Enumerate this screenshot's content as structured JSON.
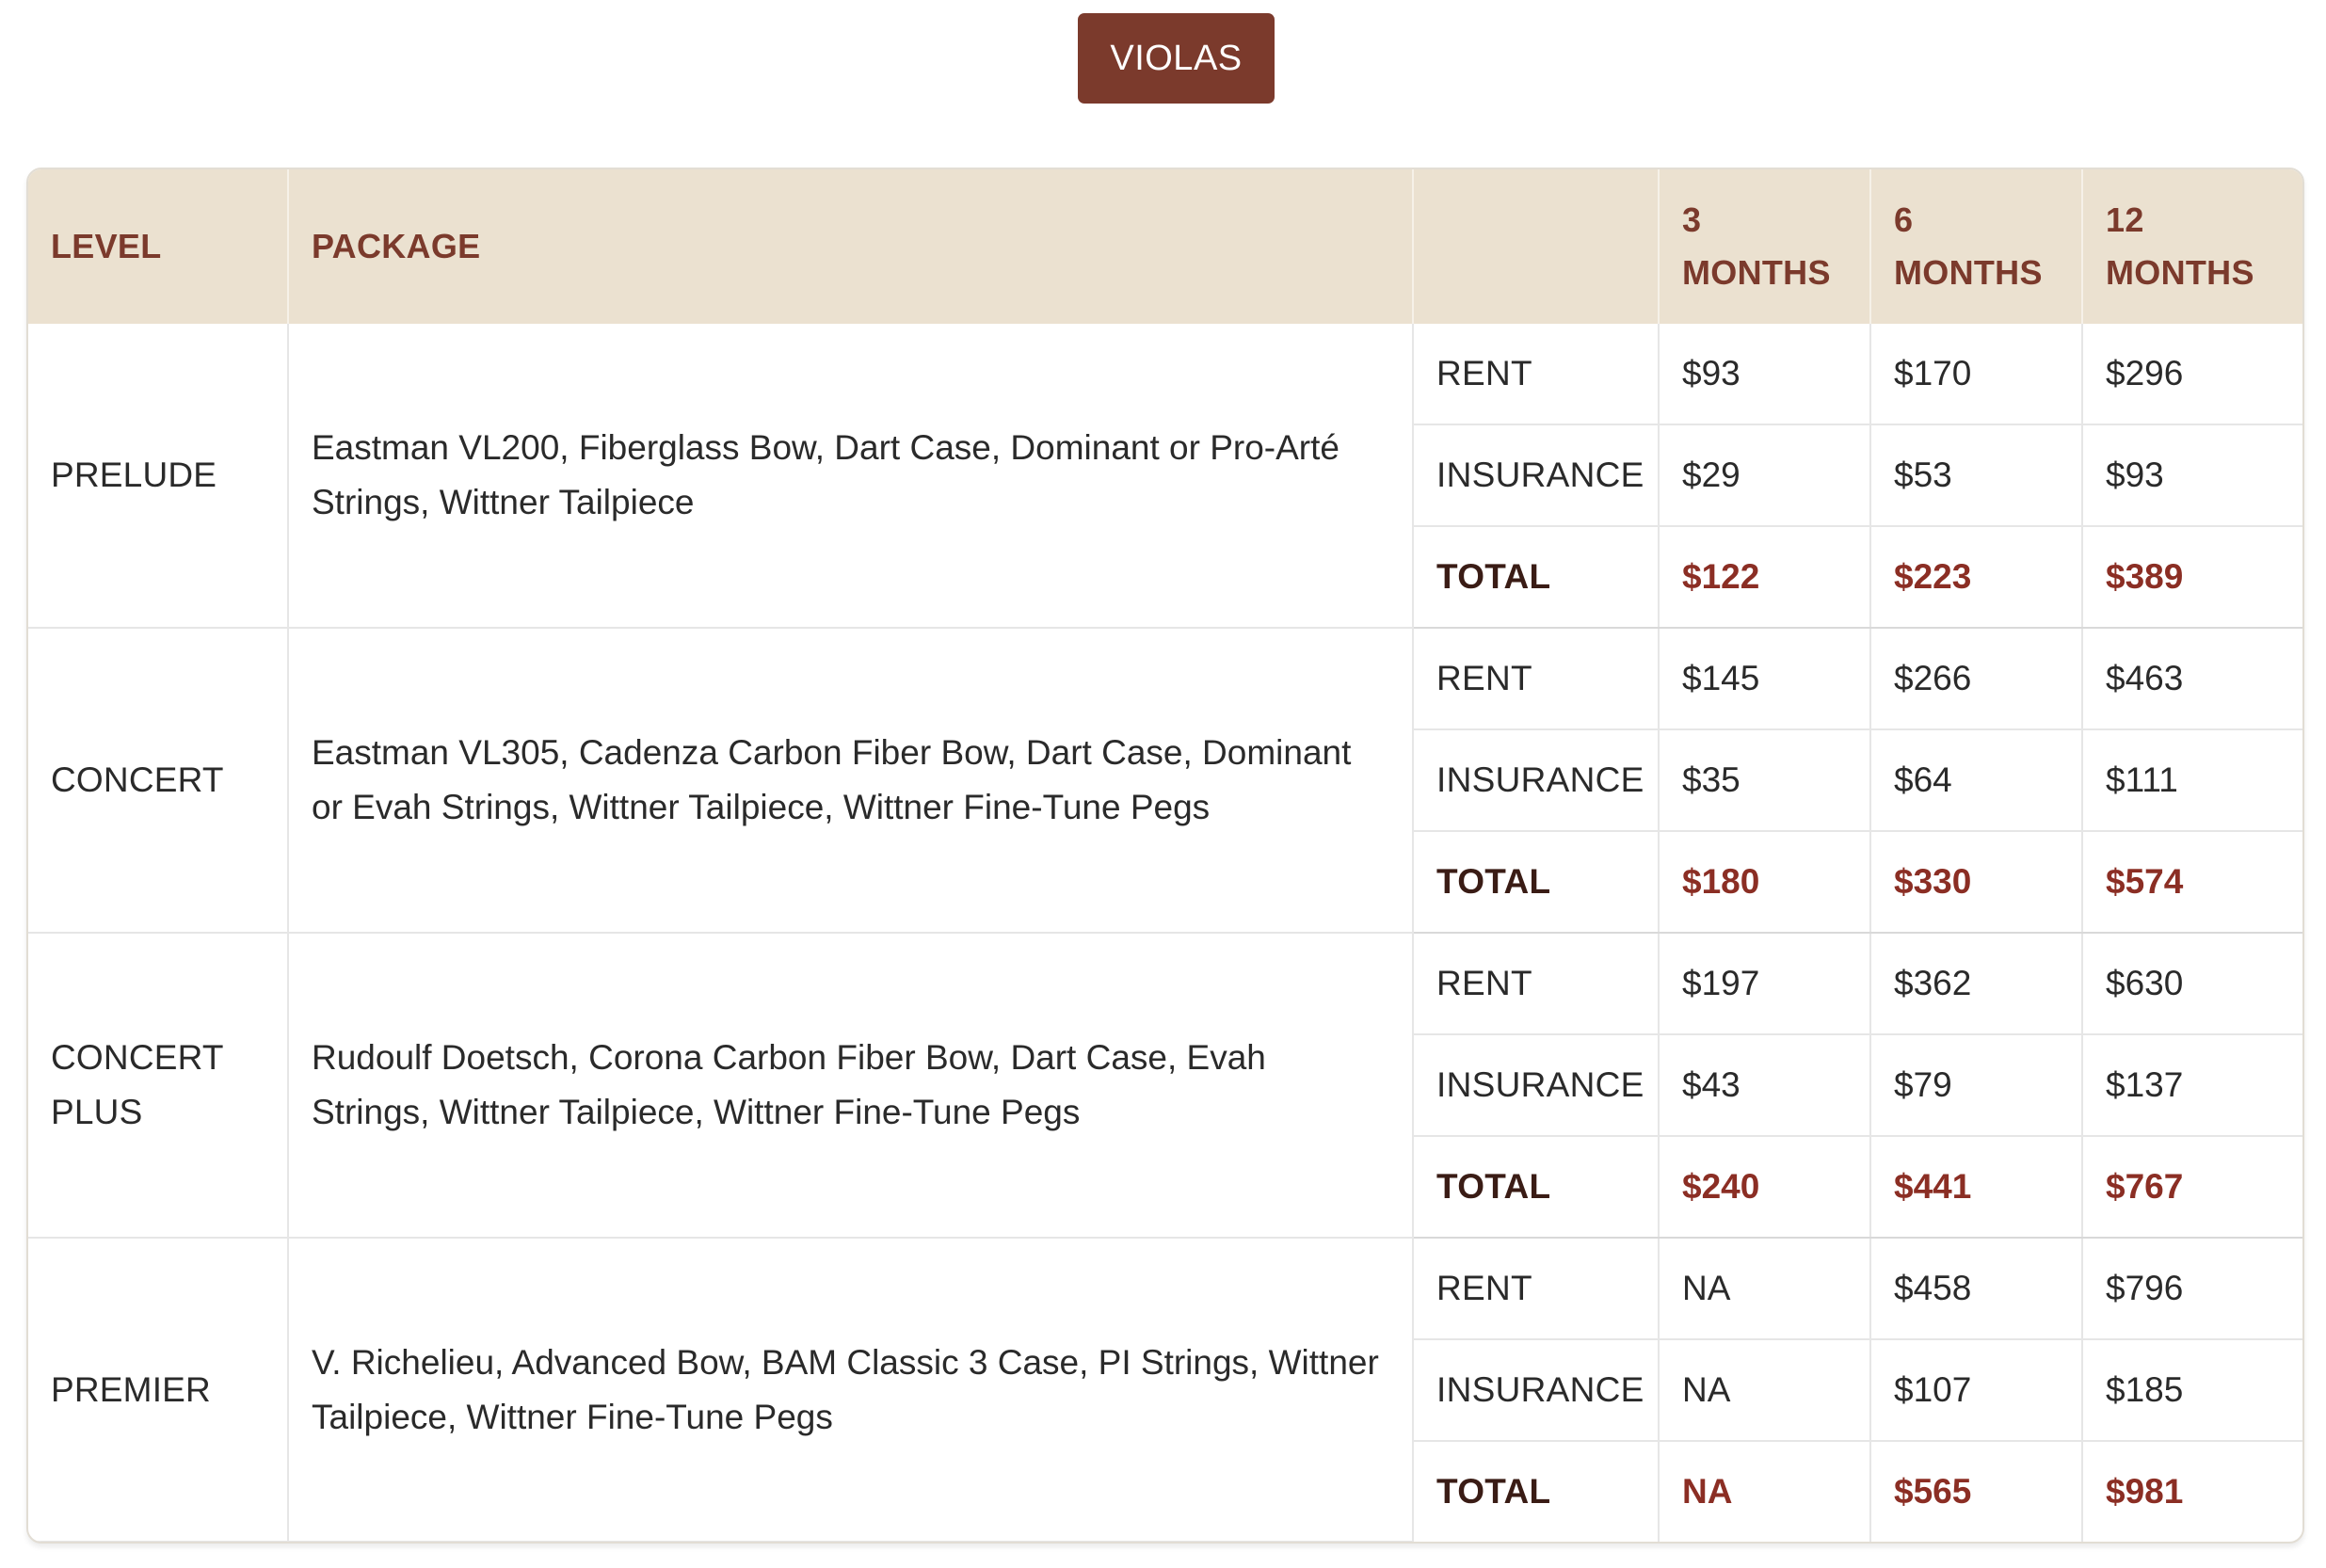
{
  "tab": {
    "label": "VIOLAS"
  },
  "table": {
    "headers": {
      "level": "LEVEL",
      "package": "PACKAGE",
      "type": "",
      "m3_num": "3",
      "m3_word": "MONTHS",
      "m6_num": "6",
      "m6_word": "MONTHS",
      "m12_num": "12",
      "m12_word": "MONTHS"
    },
    "groups": [
      {
        "level": "PRELUDE",
        "package": "Eastman VL200, Fiberglass Bow, Dart Case, Dominant or Pro-Arté Strings, Wittner Tailpiece",
        "rows": [
          {
            "type": "RENT",
            "m3": "$93",
            "m6": "$170",
            "m12": "$296"
          },
          {
            "type": "INSURANCE",
            "m3": "$29",
            "m6": "$53",
            "m12": "$93"
          },
          {
            "type": "TOTAL",
            "m3": "$122",
            "m6": "$223",
            "m12": "$389"
          }
        ]
      },
      {
        "level": "CONCERT",
        "package": "Eastman VL305, Cadenza Carbon Fiber Bow, Dart Case, Dominant or Evah Strings, Wittner Tailpiece, Wittner Fine-Tune Pegs",
        "rows": [
          {
            "type": "RENT",
            "m3": "$145",
            "m6": "$266",
            "m12": "$463"
          },
          {
            "type": "INSURANCE",
            "m3": "$35",
            "m6": "$64",
            "m12": "$111"
          },
          {
            "type": "TOTAL",
            "m3": "$180",
            "m6": "$330",
            "m12": "$574"
          }
        ]
      },
      {
        "level": "CONCERT PLUS",
        "package": "Rudoulf Doetsch, Corona Carbon Fiber Bow, Dart Case, Evah Strings, Wittner Tailpiece, Wittner Fine-Tune Pegs",
        "rows": [
          {
            "type": "RENT",
            "m3": "$197",
            "m6": "$362",
            "m12": "$630"
          },
          {
            "type": "INSURANCE",
            "m3": "$43",
            "m6": "$79",
            "m12": "$137"
          },
          {
            "type": "TOTAL",
            "m3": "$240",
            "m6": "$441",
            "m12": "$767"
          }
        ]
      },
      {
        "level": "PREMIER",
        "package": "V. Richelieu, Advanced Bow, BAM Classic 3 Case, PI Strings, Wittner Tailpiece, Wittner Fine-Tune Pegs",
        "rows": [
          {
            "type": "RENT",
            "m3": "NA",
            "m6": "$458",
            "m12": "$796"
          },
          {
            "type": "INSURANCE",
            "m3": "NA",
            "m6": "$107",
            "m12": "$185"
          },
          {
            "type": "TOTAL",
            "m3": "NA",
            "m6": "$565",
            "m12": "$981"
          }
        ]
      }
    ]
  },
  "colors": {
    "accent": "#7b3a2c",
    "header_bg": "#ebe1d0",
    "total_value": "#8b2e24"
  }
}
